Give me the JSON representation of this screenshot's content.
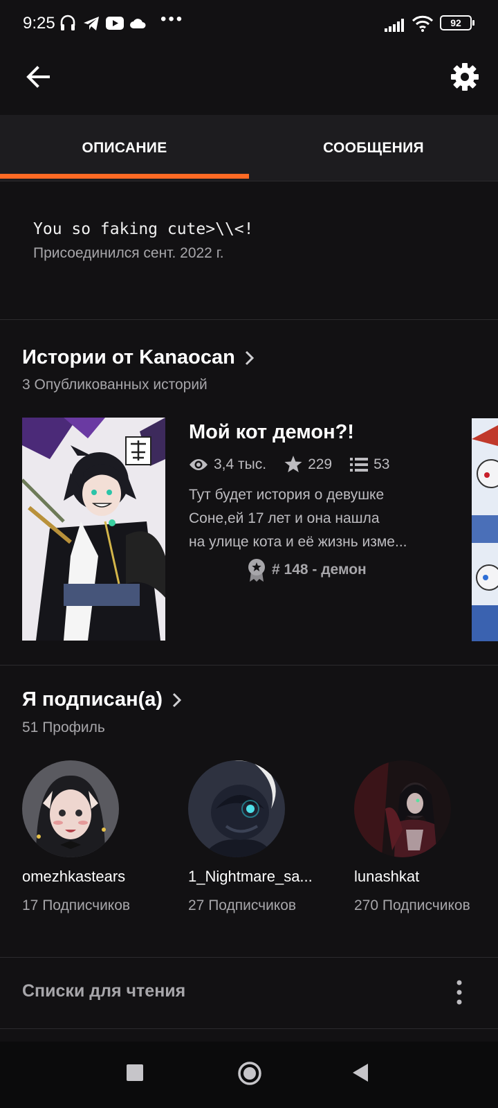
{
  "status_bar": {
    "time": "9:25",
    "battery": "92",
    "icons": [
      "headphones-icon",
      "telegram-icon",
      "youtube-icon",
      "cloud-icon",
      "more-dots",
      "signal-icon",
      "wifi-icon",
      "battery-icon"
    ],
    "dots": "•••"
  },
  "top_bar": {
    "back_icon": "arrow-left-icon",
    "settings_icon": "gear-icon"
  },
  "tabs": [
    {
      "label": "ОПИСАНИЕ",
      "active": true
    },
    {
      "label": "СООБЩЕНИЯ",
      "active": false
    }
  ],
  "accent_color": "#ff6a24",
  "about": {
    "bio": "You so faking cute>\\\\<!",
    "joined": "Присоединился сент. 2022 г."
  },
  "stories_section": {
    "title": "Истории от Kanaocan",
    "subtitle": "3 Опубликованных историй",
    "story": {
      "title": "Мой кот демон?!",
      "reads": "3,4 тыс.",
      "votes": "229",
      "parts": "53",
      "description_lines": [
        "Тут будет история о девушке",
        "Соне,ей 17 лет и она нашла",
        "на улице кота и её жизнь изме..."
      ],
      "rank": "# 148 - демон"
    }
  },
  "following_section": {
    "title": "Я подписан(а)",
    "subtitle": "51 Профиль",
    "profiles": [
      {
        "name": "omezhkastears",
        "followers": "17 Подписчиков"
      },
      {
        "name": "1_Nightmare_sa...",
        "followers": "27 Подписчиков"
      },
      {
        "name": "lunashkat",
        "followers": "270 Подписчиков"
      }
    ]
  },
  "reading_lists": {
    "title": "Списки для чтения",
    "menu_icon": "more-vertical-icon"
  },
  "nav_bar": {
    "icons": [
      "recents-square-icon",
      "home-circle-icon",
      "back-triangle-icon"
    ]
  }
}
